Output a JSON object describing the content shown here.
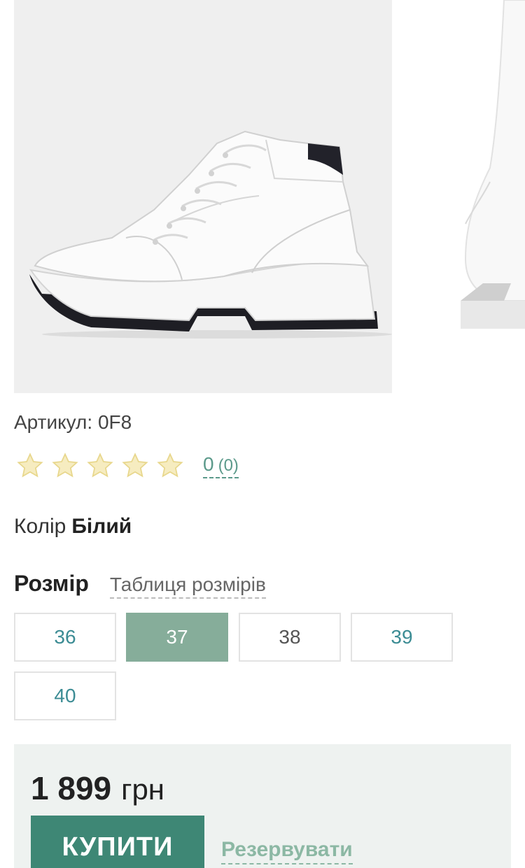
{
  "gallery": {
    "images": [
      {
        "icon": "white-sneaker-photo"
      },
      {
        "icon": "white-boot-photo"
      }
    ]
  },
  "article": {
    "label": "Артикул:",
    "value": "0F8"
  },
  "rating": {
    "stars_total": 5,
    "stars_filled": 0,
    "score": "0",
    "reviews": "(0)",
    "star_color": "#f4e8b4"
  },
  "color": {
    "label": "Колір",
    "value": "Білий"
  },
  "size": {
    "title": "Розмір",
    "table_link": "Таблиця розмірів",
    "options": [
      "36",
      "37",
      "38",
      "39",
      "40"
    ],
    "selected": "37"
  },
  "purchase": {
    "price": "1 899",
    "currency": "грн",
    "buy_label": "КУПИТИ",
    "reserve_label": "Резервувати",
    "accent": "#3e8775"
  }
}
